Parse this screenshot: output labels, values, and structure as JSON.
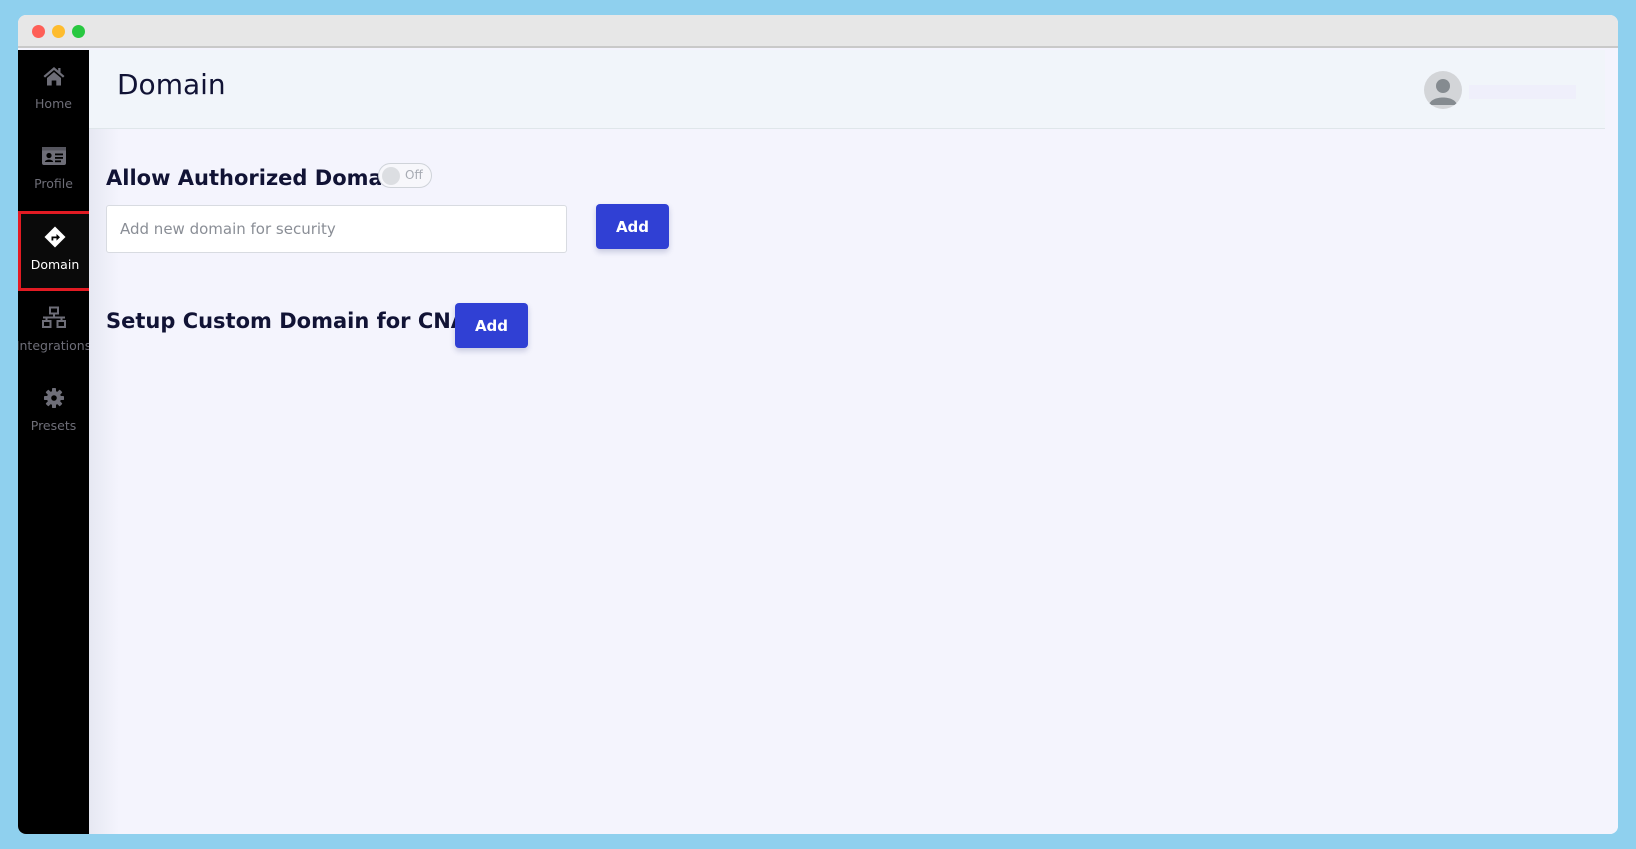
{
  "window": {
    "controls": [
      "close",
      "minimize",
      "maximize"
    ]
  },
  "sidebar": {
    "items": [
      {
        "label": "Home",
        "icon": "home-icon",
        "active": false
      },
      {
        "label": "Profile",
        "icon": "id-card-icon",
        "active": false
      },
      {
        "label": "Domain",
        "icon": "directions-sign-icon",
        "active": true
      },
      {
        "label": "Integrations",
        "icon": "network-icon",
        "active": false
      },
      {
        "label": "Presets",
        "icon": "gear-icon",
        "active": false
      }
    ]
  },
  "header": {
    "title": "Domain",
    "avatar_icon": "user-avatar-icon"
  },
  "authorized_domain": {
    "title": "Allow Authorized Domain",
    "toggle_label": "Off",
    "toggle_state": false,
    "input_value": "",
    "input_placeholder": "Add new domain for security",
    "add_label": "Add"
  },
  "custom_domain": {
    "title": "Setup Custom Domain for CNAME",
    "add_label": "Add"
  },
  "colors": {
    "accent": "#3040d4",
    "active_highlight": "#e21b23",
    "sidebar_bg": "#000000",
    "page_bg": "#f4f4fd"
  }
}
